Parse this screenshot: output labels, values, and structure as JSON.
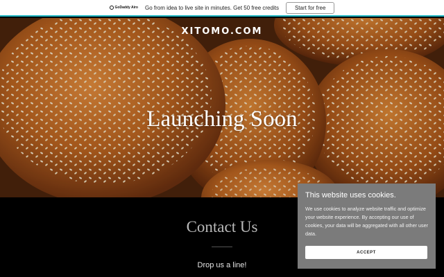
{
  "promo": {
    "logo_text": "GoDaddy Airo",
    "message": "Go from idea to live site in minutes. Get 50 free credits",
    "cta": "Start for free"
  },
  "hero": {
    "brand": "XITOMO.COM",
    "title": "Launching Soon"
  },
  "contact": {
    "title": "Contact Us",
    "subtitle": "Drop us a line!"
  },
  "cookie": {
    "title": "This website uses cookies.",
    "body": "We use cookies to analyze website traffic and optimize your website experience. By accepting our use of cookies, your data will be aggregated with all other user data.",
    "accept": "ACCEPT"
  },
  "colors": {
    "promo_border": "#1bb3bf",
    "cookie_bg": "#7b7b7b",
    "contact_bg": "#000000"
  }
}
